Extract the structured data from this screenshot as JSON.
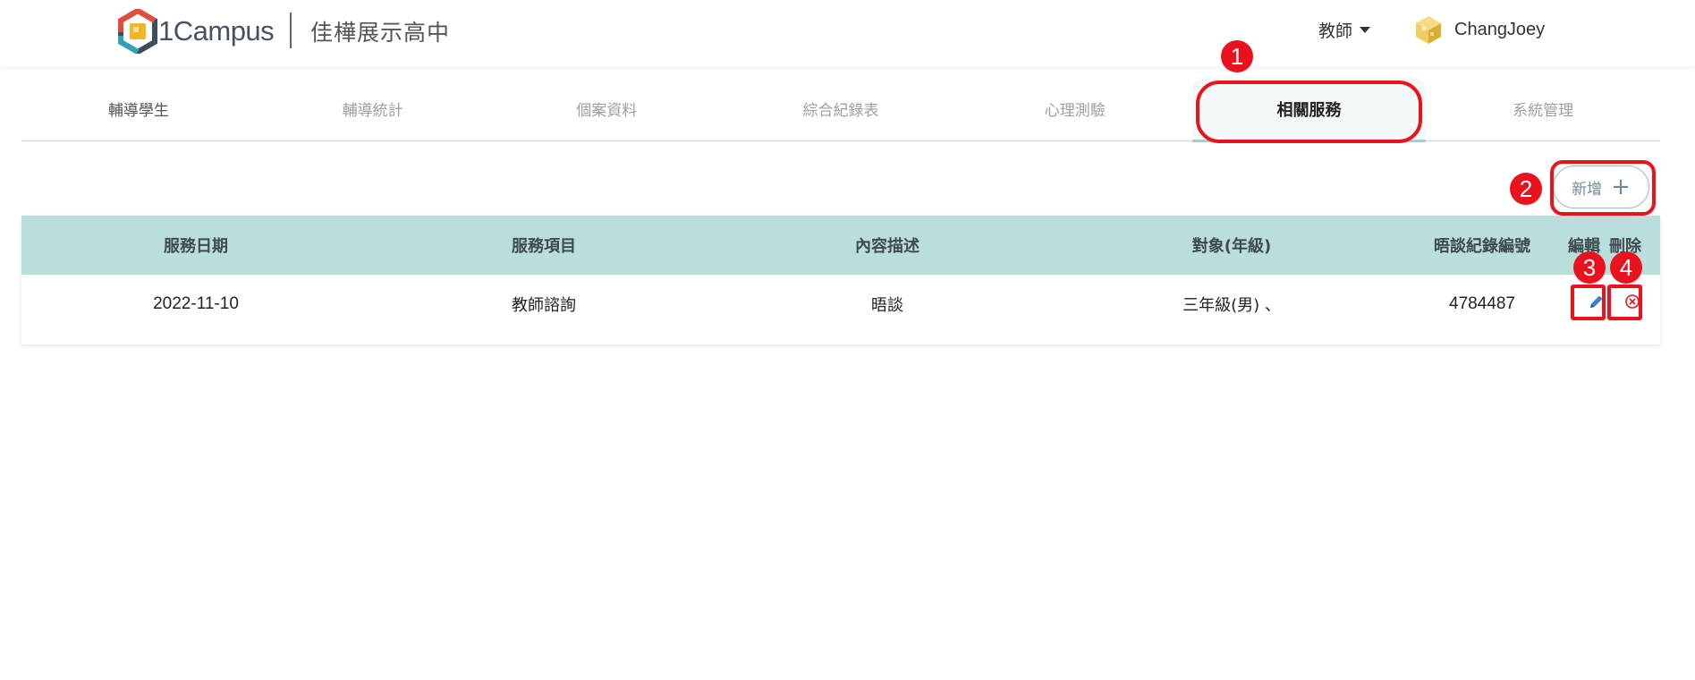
{
  "header": {
    "logo_text": "1Campus",
    "school_name": "佳樺展示高中",
    "role": "教師",
    "user_name": "ChangJoey"
  },
  "tabs": [
    {
      "label": "輔導學生"
    },
    {
      "label": "輔導統計"
    },
    {
      "label": "個案資料"
    },
    {
      "label": "綜合紀錄表"
    },
    {
      "label": "心理測驗"
    },
    {
      "label": "相關服務",
      "active": true
    },
    {
      "label": "系統管理"
    }
  ],
  "toolbar": {
    "add_label": "新增"
  },
  "table": {
    "columns": [
      "服務日期",
      "服務項目",
      "內容描述",
      "對象(年級)",
      "晤談紀錄編號",
      "編輯",
      "刪除"
    ],
    "rows": [
      {
        "date": "2022-11-10",
        "item": "教師諮詢",
        "desc": "晤談",
        "target": "三年級(男) 、",
        "record_no": "4784487"
      }
    ]
  },
  "annotations": [
    "1",
    "2",
    "3",
    "4"
  ],
  "colors": {
    "header_row": "#b9dedb",
    "annotation": "#e8131d",
    "edit_icon": "#3d7fd6",
    "delete_icon": "#e8131d"
  }
}
